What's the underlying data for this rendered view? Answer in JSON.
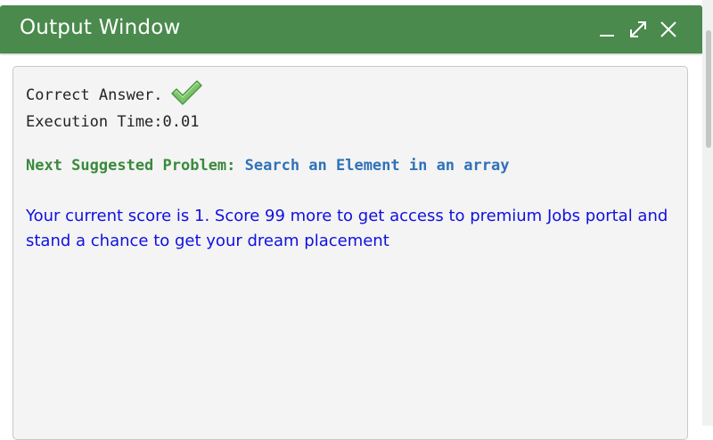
{
  "window": {
    "title": "Output Window",
    "header_color": "#4a8a4d",
    "controls": [
      "minimize-icon",
      "maximize-icon",
      "close-icon"
    ]
  },
  "output": {
    "result_text": "Correct Answer.",
    "result_icon": "checkmark-icon",
    "execution_time": "Execution Time:0.01",
    "next_label": "Next Suggested Problem:",
    "next_problem": "Search an Element in an array",
    "score_message": "Your current score is 1. Score 99 more to get access to premium Jobs portal and stand a chance to get your dream placement"
  },
  "colors": {
    "label_green": "#3a8a3c",
    "link_blue": "#2f72b8",
    "score_blue": "#1010e0"
  }
}
